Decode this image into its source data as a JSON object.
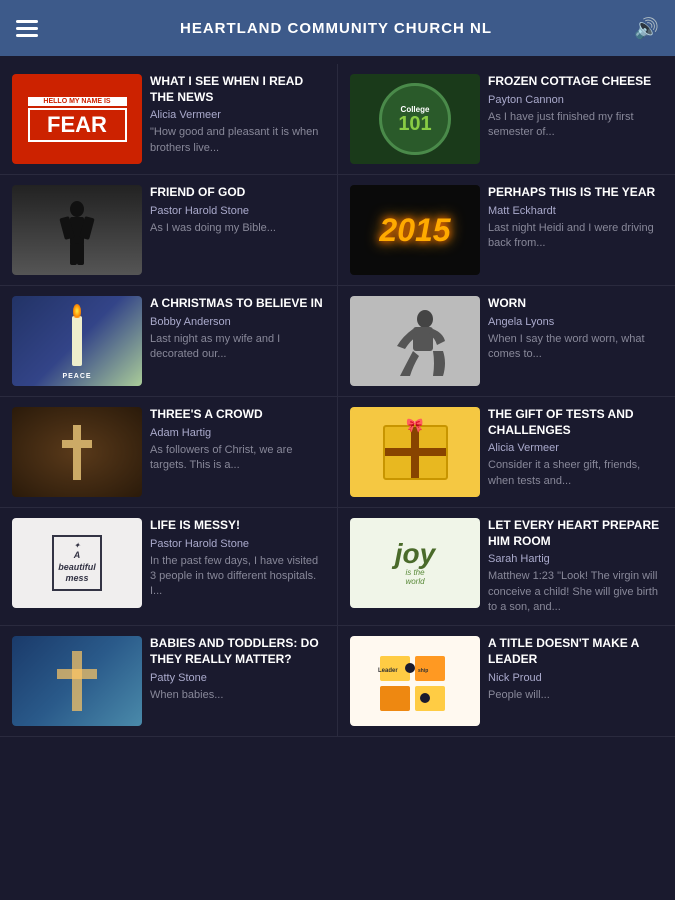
{
  "header": {
    "title": "HEARTLAND COMMUNITY CHURCH NL"
  },
  "articles": [
    {
      "id": "fear",
      "title": "WHAT I SEE WHEN I READ THE NEWS",
      "author": "Alicia Vermeer",
      "excerpt": "\"How good and pleasant it is when brothers live...",
      "thumb_label": "HELLO MY NAME IS FEAR",
      "thumb_type": "fear"
    },
    {
      "id": "college",
      "title": "FROZEN COTTAGE CHEESE",
      "author": "Payton Cannon",
      "excerpt": "As I have just finished my first semester of...",
      "thumb_type": "college"
    },
    {
      "id": "friend",
      "title": "FRIEND OF GOD",
      "author": "Pastor Harold Stone",
      "excerpt": "As I was doing my Bible...",
      "thumb_type": "friend"
    },
    {
      "id": "2015",
      "title": "PERHAPS THIS IS THE YEAR",
      "author": "Matt Eckhardt",
      "excerpt": "Last night Heidi and I were driving back from...",
      "thumb_type": "2015",
      "thumb_label": "2015"
    },
    {
      "id": "christmas",
      "title": "A CHRISTMAS TO BELIEVE IN",
      "author": "Bobby Anderson",
      "excerpt": "Last night as my wife and I decorated our...",
      "thumb_type": "candle"
    },
    {
      "id": "worn",
      "title": "WORN",
      "author": "Angela Lyons",
      "excerpt": "When I say the word worn, what comes to...",
      "thumb_type": "worn"
    },
    {
      "id": "crowd",
      "title": "THREE'S A CROWD",
      "author": "Adam Hartig",
      "excerpt": "As followers of Christ, we are targets. This is a...",
      "thumb_type": "cross"
    },
    {
      "id": "gift",
      "title": "THE GIFT OF TESTS AND CHALLENGES",
      "author": "Alicia Vermeer",
      "excerpt": "Consider it a sheer gift, friends, when tests and...",
      "thumb_type": "gift"
    },
    {
      "id": "messy",
      "title": "LIFE IS MESSY!",
      "author": "Pastor Harold Stone",
      "excerpt": "In the past few days, I have visited 3 people in two different hospitals. I...",
      "thumb_type": "mess",
      "thumb_label": "A beautiful mess"
    },
    {
      "id": "joy",
      "title": "LET EVERY HEART PREPARE HIM ROOM",
      "author": "Sarah Hartig",
      "excerpt": "Matthew 1:23 \"Look! The virgin will conceive a child! She will give birth to a son, and...",
      "thumb_type": "joy",
      "thumb_label": "joy"
    },
    {
      "id": "babies",
      "title": "BABIES AND TODDLERS: DO THEY REALLY MATTER?",
      "author": "Patty Stone",
      "excerpt": "When babies...",
      "thumb_type": "stained"
    },
    {
      "id": "leader",
      "title": "A TITLE DOESN'T MAKE A LEADER",
      "author": "Nick Proud",
      "excerpt": "People will...",
      "thumb_type": "puzzle"
    }
  ]
}
